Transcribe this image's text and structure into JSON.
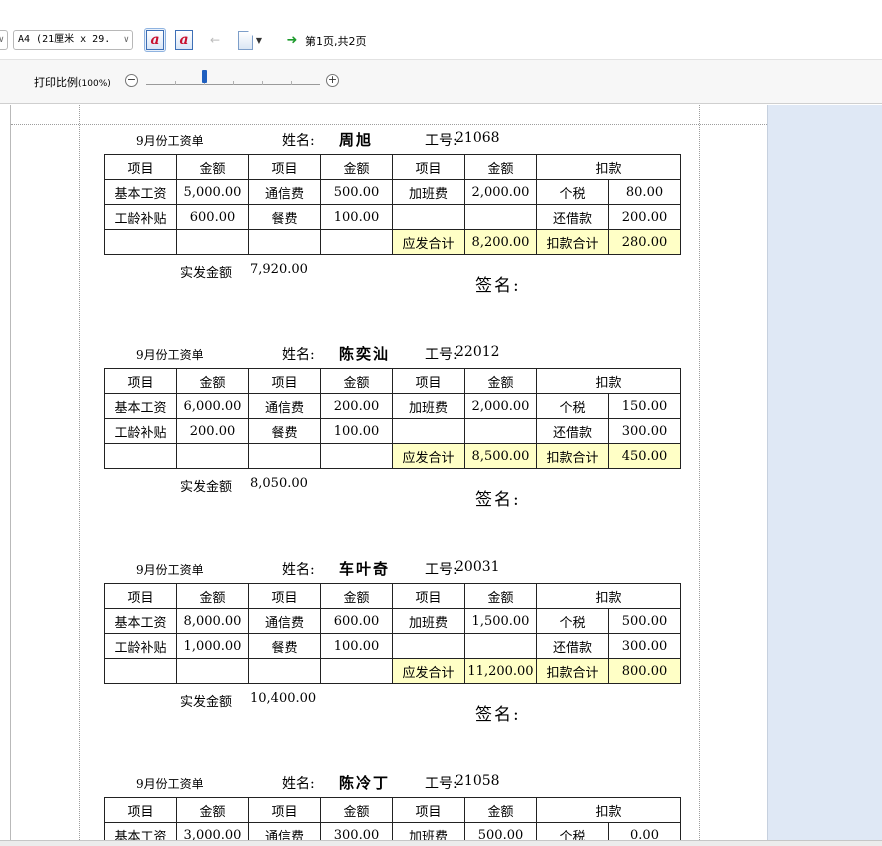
{
  "toolbar": {
    "left_dropdown_arrow": "∨",
    "paper_size": "A4 (21厘米 x 29.",
    "paper_size_arrow": "∨",
    "letter_a1": "a",
    "letter_a2": "a",
    "prev_arrow": "←",
    "next_arrow": "➜",
    "doc_caret": "▼",
    "page_info": "第1页,共2页"
  },
  "zoom": {
    "label": "打印比例",
    "percent": "(100%)",
    "minus": "−",
    "plus": "+",
    "value_percent": 100
  },
  "headers": {
    "col1": "项目",
    "col2": "金额",
    "col3": "项目",
    "col4": "金额",
    "col5": "项目",
    "col6": "金额",
    "col7": "扣款"
  },
  "labels": {
    "month_title": "9月份工资单",
    "name_label": "姓名:",
    "id_label": "工号:",
    "base": "基本工资",
    "telecom": "通信费",
    "overtime": "加班费",
    "tax": "个税",
    "seniority": "工龄补贴",
    "meal": "餐费",
    "loan": "还借款",
    "gross_total": "应发合计",
    "deduction_total": "扣款合计",
    "net_label": "实发金额",
    "sign_label": "签名:"
  },
  "slips": [
    {
      "name": "周旭",
      "id": "21068",
      "base": "5,000.00",
      "telecom": "500.00",
      "overtime": "2,000.00",
      "tax": "80.00",
      "seniority": "600.00",
      "meal": "100.00",
      "loan": "200.00",
      "gross": "8,200.00",
      "deduction": "280.00",
      "net": "7,920.00"
    },
    {
      "name": "陈奕汕",
      "id": "22012",
      "base": "6,000.00",
      "telecom": "200.00",
      "overtime": "2,000.00",
      "tax": "150.00",
      "seniority": "200.00",
      "meal": "100.00",
      "loan": "300.00",
      "gross": "8,500.00",
      "deduction": "450.00",
      "net": "8,050.00"
    },
    {
      "name": "车叶奇",
      "id": "20031",
      "base": "8,000.00",
      "telecom": "600.00",
      "overtime": "1,500.00",
      "tax": "500.00",
      "seniority": "1,000.00",
      "meal": "100.00",
      "loan": "300.00",
      "gross": "11,200.00",
      "deduction": "800.00",
      "net": "10,400.00"
    },
    {
      "name": "陈冷丁",
      "id": "21058",
      "base": "3,000.00",
      "telecom": "300.00",
      "overtime": "500.00",
      "tax": "0.00",
      "seniority": "",
      "meal": "",
      "loan": "",
      "gross": "",
      "deduction": "",
      "net": ""
    }
  ]
}
